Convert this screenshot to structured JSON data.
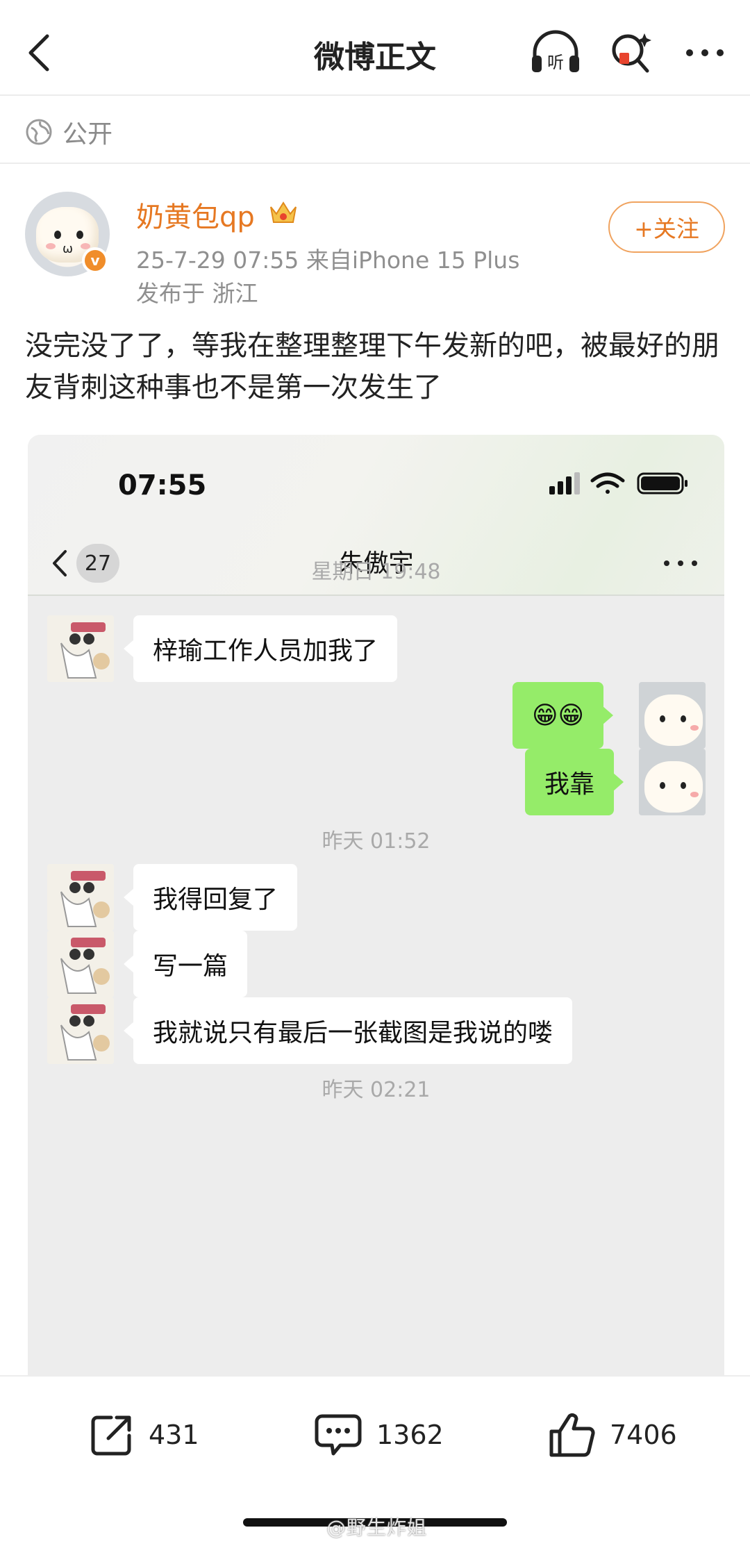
{
  "nav": {
    "title": "微博正文",
    "listen_label": "听"
  },
  "visibility": "公开",
  "author": {
    "name": "奶黄包qp",
    "meta": "25-7-29 07:55  来自iPhone 15 Plus",
    "location": "发布于 浙江",
    "follow_label": "+关注"
  },
  "post": {
    "text": "没完没了了，等我在整理整理下午发新的吧，被最好的朋友背刺这种事也不是第一次发生了"
  },
  "chat_screenshot": {
    "status_time": "07:55",
    "back_badge": "27",
    "contact_name": "朱傲宇",
    "messages": [
      {
        "type": "time",
        "text": "星期日 19:48"
      },
      {
        "type": "left",
        "text": "梓瑜工作人员加我了"
      },
      {
        "type": "right",
        "text": "😁😁"
      },
      {
        "type": "right",
        "text": "我靠"
      },
      {
        "type": "time",
        "text": "昨天 01:52"
      },
      {
        "type": "left",
        "text": "我得回复了"
      },
      {
        "type": "left",
        "text": "写一篇"
      },
      {
        "type": "left",
        "text": "我就说只有最后一张截图是我说的喽"
      },
      {
        "type": "time",
        "text": "昨天 02:21"
      }
    ]
  },
  "actions": {
    "reposts": "431",
    "comments": "1362",
    "likes": "7406"
  },
  "watermark": "@野生炸姐",
  "colors": {
    "accent_orange": "#e67822",
    "chat_bubble_green": "#95ec69",
    "chat_bg": "#ededed"
  },
  "icons": [
    "back-icon",
    "headphones-icon",
    "search-icon",
    "more-icon",
    "globe-icon",
    "crown-icon",
    "verified-icon",
    "signal-icon",
    "wifi-icon",
    "battery-icon",
    "repost-icon",
    "comment-icon",
    "like-icon"
  ]
}
